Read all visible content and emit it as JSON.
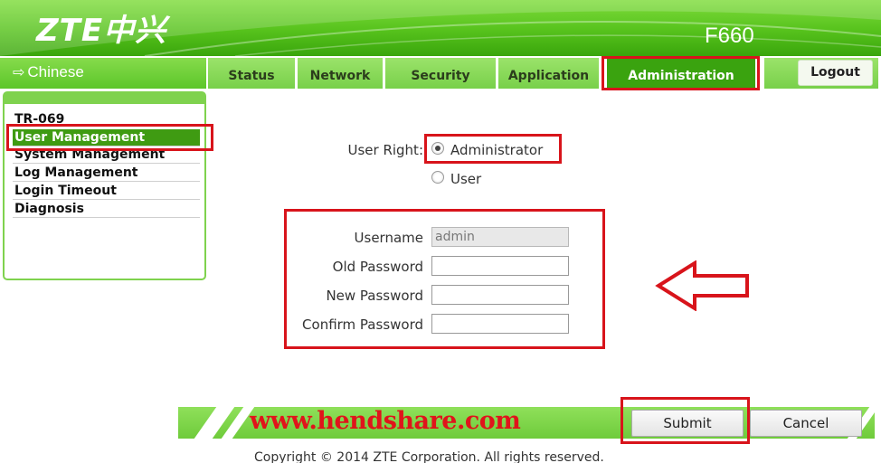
{
  "header": {
    "logo": "ZTE中兴",
    "model": "F660"
  },
  "nav": {
    "language_label": "Chinese",
    "tabs": [
      {
        "label": "Status"
      },
      {
        "label": "Network"
      },
      {
        "label": "Security"
      },
      {
        "label": "Application"
      },
      {
        "label": "Administration",
        "active": true
      }
    ],
    "logout_label": "Logout"
  },
  "sidebar": {
    "items": [
      {
        "label": "TR-069"
      },
      {
        "label": "User Management",
        "active": true
      },
      {
        "label": "System Management"
      },
      {
        "label": "Log Management"
      },
      {
        "label": "Login Timeout"
      },
      {
        "label": "Diagnosis"
      }
    ]
  },
  "form": {
    "user_right_label": "User Right:",
    "rights": [
      {
        "label": "Administrator",
        "checked": true
      },
      {
        "label": "User",
        "checked": false
      }
    ],
    "username_label": "Username",
    "username_value": "admin",
    "old_password_label": "Old Password",
    "new_password_label": "New Password",
    "confirm_password_label": "Confirm Password"
  },
  "footer": {
    "watermark": "www.hendshare.com",
    "submit_label": "Submit",
    "cancel_label": "Cancel",
    "copyright": "Copyright © 2014 ZTE Corporation. All rights reserved."
  },
  "colors": {
    "brand_green": "#56c21c",
    "active_green": "#3aa30f",
    "annotation_red": "#d8141b"
  },
  "icons": {
    "language": "arrow-right-icon",
    "pointer": "left-arrow-annotation-icon"
  }
}
